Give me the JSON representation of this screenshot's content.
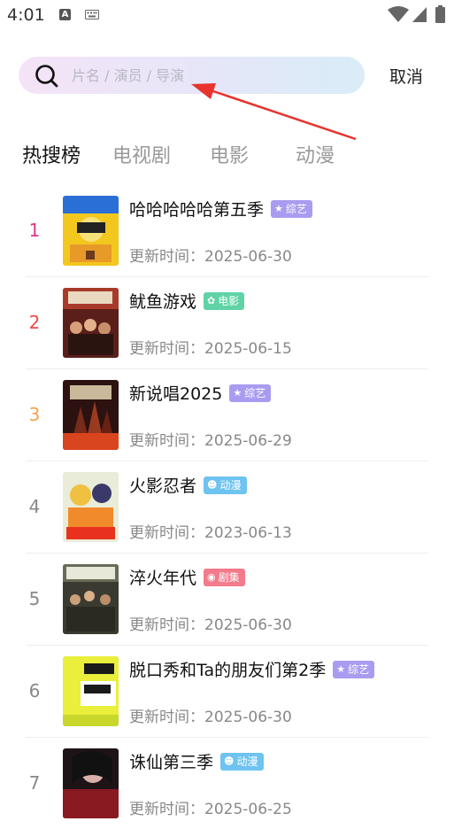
{
  "status_bar": {
    "time": "4:01",
    "a_badge": "A",
    "icons": [
      "a-badge-icon",
      "keyboard-icon",
      "wifi-icon",
      "cellular-icon",
      "battery-icon"
    ]
  },
  "search": {
    "placeholder": "片名 / 演员 / 导演",
    "value": "",
    "cancel_label": "取消"
  },
  "tabs": [
    {
      "label": "热搜榜",
      "active": true
    },
    {
      "label": "电视剧",
      "active": false
    },
    {
      "label": "电影",
      "active": false
    },
    {
      "label": "动漫",
      "active": false
    }
  ],
  "update_label": "更新时间：",
  "items": [
    {
      "rank": "1",
      "rank_color": "#e0338a",
      "title": "哈哈哈哈哈第五季",
      "tag": "综艺",
      "tag_color": "#a99cf0",
      "tag_icon": "variety-icon",
      "date": "2025-06-30"
    },
    {
      "rank": "2",
      "rank_color": "#f04848",
      "title": "鱿鱼游戏",
      "tag": "电影",
      "tag_color": "#5fd3a6",
      "tag_icon": "film-reel-icon",
      "date": "2025-06-15"
    },
    {
      "rank": "3",
      "rank_color": "#f5a24a",
      "title": "新说唱2025",
      "tag": "综艺",
      "tag_color": "#a99cf0",
      "tag_icon": "variety-icon",
      "date": "2025-06-29"
    },
    {
      "rank": "4",
      "rank_color": "#888888",
      "title": "火影忍者",
      "tag": "动漫",
      "tag_color": "#6fc3f0",
      "tag_icon": "anime-icon",
      "date": "2023-06-13"
    },
    {
      "rank": "5",
      "rank_color": "#888888",
      "title": "淬火年代",
      "tag": "剧集",
      "tag_color": "#f27a8a",
      "tag_icon": "drama-icon",
      "date": "2025-06-30"
    },
    {
      "rank": "6",
      "rank_color": "#888888",
      "title": "脱口秀和Ta的朋友们第2季",
      "tag": "综艺",
      "tag_color": "#a99cf0",
      "tag_icon": "variety-icon",
      "date": "2025-06-30"
    },
    {
      "rank": "7",
      "rank_color": "#888888",
      "title": "诛仙第三季",
      "tag": "动漫",
      "tag_color": "#6fc3f0",
      "tag_icon": "anime-icon",
      "date": "2025-06-25"
    }
  ]
}
